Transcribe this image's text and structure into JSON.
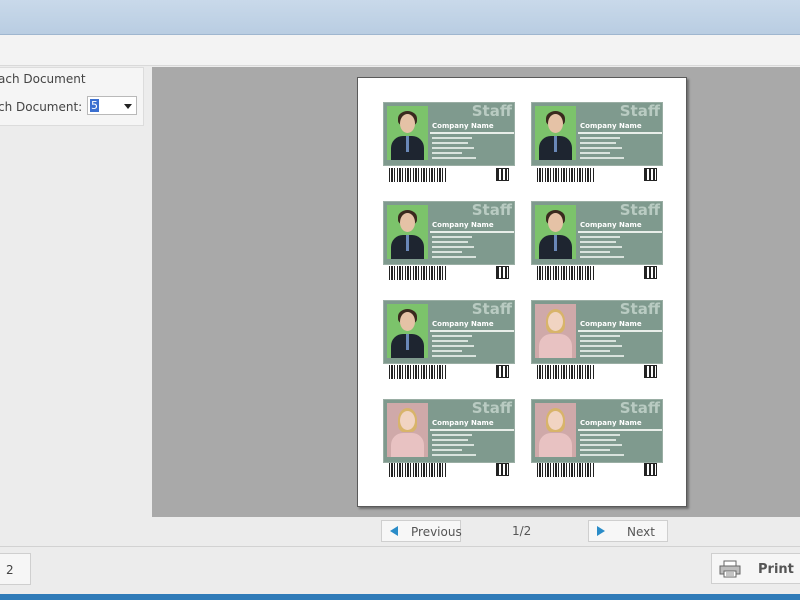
{
  "left_panel": {
    "line1": "ach Document",
    "line2_label": "ch Document:",
    "select_value": "5"
  },
  "preview": {
    "cards": [
      {
        "staff": "Staff",
        "company": "Company Name",
        "photo": "male"
      },
      {
        "staff": "Staff",
        "company": "Company Name",
        "photo": "male"
      },
      {
        "staff": "Staff",
        "company": "Company Name",
        "photo": "male"
      },
      {
        "staff": "Staff",
        "company": "Company Name",
        "photo": "male"
      },
      {
        "staff": "Staff",
        "company": "Company Name",
        "photo": "male"
      },
      {
        "staff": "Staff",
        "company": "Company Name",
        "photo": "female"
      },
      {
        "staff": "Staff",
        "company": "Company Name",
        "photo": "female"
      },
      {
        "staff": "Staff",
        "company": "Company Name",
        "photo": "female"
      }
    ]
  },
  "navigation": {
    "previous": "Previous",
    "page_indicator": "1/2",
    "next": "Next"
  },
  "footer": {
    "left_button": "2",
    "print": "Print"
  },
  "colors": {
    "card_bg": "#7f9a8e",
    "preview_bg": "#a9a9a9",
    "accent_arrow": "#2a8cc8",
    "bottom_line": "#2f7bb8"
  }
}
